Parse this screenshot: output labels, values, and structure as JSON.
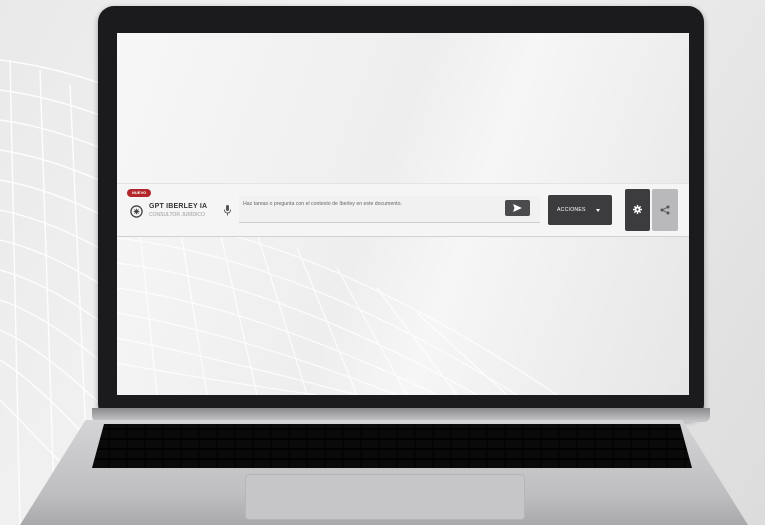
{
  "toolbar": {
    "badge": "NUEVO",
    "brand_title": "GPT IBERLEY IA",
    "brand_subtitle": "CONSULTOR JURÍDICO",
    "prompt_placeholder": "Haz tareas o pregunta con el contexto de Iberley en este documento.",
    "actions_label": "ACCIONES",
    "icons": [
      "logo-icon",
      "microphone-icon",
      "send-icon",
      "caret-down-icon",
      "gear-icon",
      "share-icon"
    ]
  },
  "colors": {
    "badge": "#b3262b",
    "dark_button": "#3c3c3e",
    "share_button": "#b9b9bb",
    "laptop_bezel": "#1b1b1d"
  }
}
